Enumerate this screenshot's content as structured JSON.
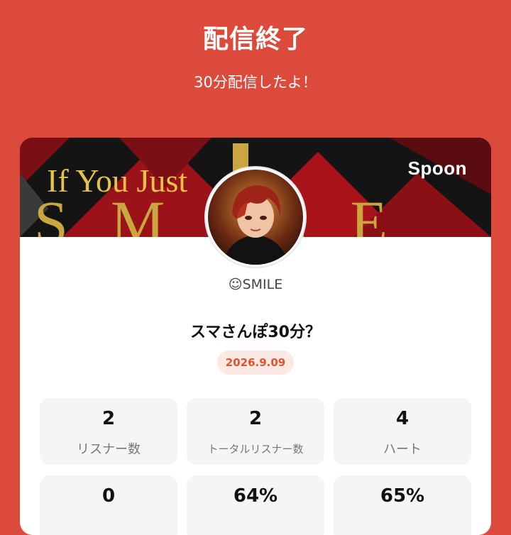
{
  "header": {
    "title": "配信終了",
    "subtitle": "30分配信したよ！"
  },
  "card": {
    "brand": "Spoon",
    "banner_text_line1": "If You Just",
    "banner_text_line2": "SMILE",
    "username": "☺SMILE",
    "stream_title": "スマさんぽ30分？",
    "date": "2026.9.09",
    "stats": [
      {
        "value": "2",
        "label": "リスナー数"
      },
      {
        "value": "2",
        "label": "トータルリスナー数"
      },
      {
        "value": "4",
        "label": "ハート"
      },
      {
        "value": "0",
        "label": ""
      },
      {
        "value": "64%",
        "label": ""
      },
      {
        "value": "65%",
        "label": ""
      }
    ]
  },
  "colors": {
    "background": "#db4a3a",
    "badge_text": "#e0532f",
    "badge_bg": "#fde9e3"
  }
}
